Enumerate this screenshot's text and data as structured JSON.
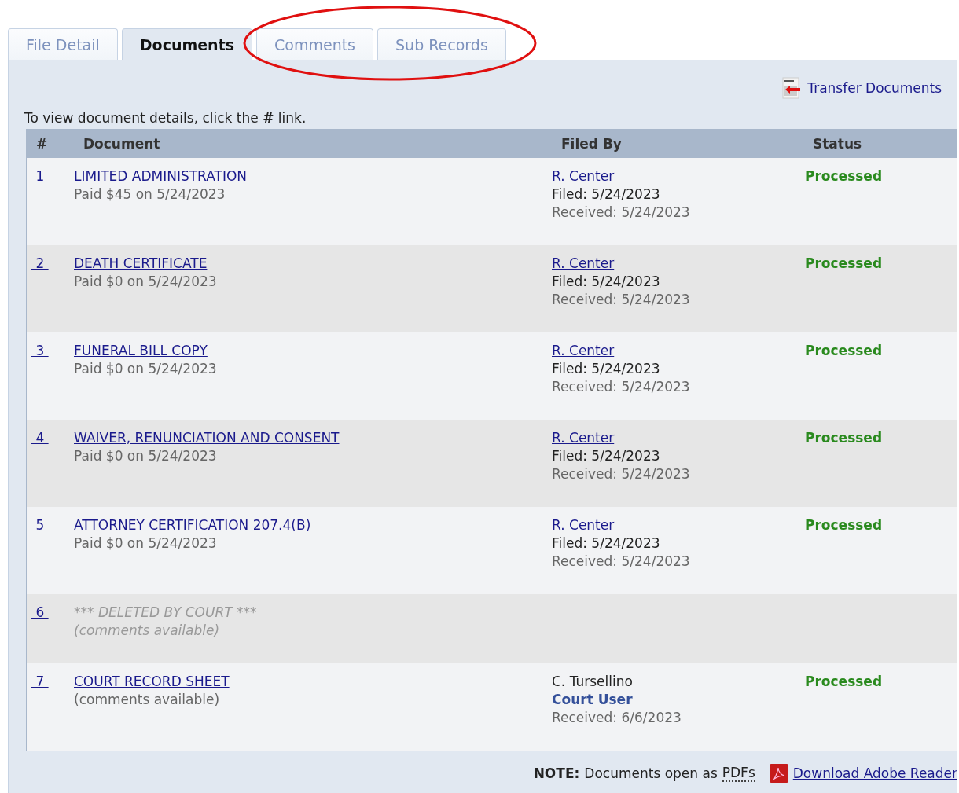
{
  "tabs": [
    {
      "label": "File Detail",
      "selected": false
    },
    {
      "label": "Documents",
      "selected": true
    },
    {
      "label": "Comments",
      "selected": false
    },
    {
      "label": "Sub Records",
      "selected": false
    }
  ],
  "transfer_link": "Transfer Documents",
  "instructions": "To view document details, click the **#** link.",
  "table": {
    "columns": [
      "#",
      "Document",
      "Filed By",
      "Status"
    ],
    "rows": [
      {
        "number": "1",
        "title": "LIMITED ADMINISTRATION",
        "deleted": false,
        "subtitle": "Paid $45 on 5/24/2023",
        "filed_by": [
          {
            "kind": "link",
            "text": "R. Center"
          },
          {
            "kind": "text",
            "text": "Filed: 5/24/2023"
          },
          {
            "kind": "muted",
            "text": "Received: 5/24/2023"
          }
        ],
        "status": "Processed"
      },
      {
        "number": "2",
        "title": "DEATH CERTIFICATE",
        "deleted": false,
        "subtitle": "Paid $0 on 5/24/2023",
        "filed_by": [
          {
            "kind": "link",
            "text": "R. Center"
          },
          {
            "kind": "text",
            "text": "Filed: 5/24/2023"
          },
          {
            "kind": "muted",
            "text": "Received: 5/24/2023"
          }
        ],
        "status": "Processed"
      },
      {
        "number": "3",
        "title": "FUNERAL BILL COPY",
        "deleted": false,
        "subtitle": "Paid $0 on 5/24/2023",
        "filed_by": [
          {
            "kind": "link",
            "text": "R. Center"
          },
          {
            "kind": "text",
            "text": "Filed: 5/24/2023"
          },
          {
            "kind": "muted",
            "text": "Received: 5/24/2023"
          }
        ],
        "status": "Processed"
      },
      {
        "number": "4",
        "title": "WAIVER, RENUNCIATION AND CONSENT",
        "deleted": false,
        "subtitle": "Paid $0 on 5/24/2023",
        "filed_by": [
          {
            "kind": "link",
            "text": "R. Center"
          },
          {
            "kind": "text",
            "text": "Filed: 5/24/2023"
          },
          {
            "kind": "muted",
            "text": "Received: 5/24/2023"
          }
        ],
        "status": "Processed"
      },
      {
        "number": "5",
        "title": "ATTORNEY CERTIFICATION 207.4(B)",
        "deleted": false,
        "subtitle": "Paid $0 on 5/24/2023",
        "filed_by": [
          {
            "kind": "link",
            "text": "R. Center"
          },
          {
            "kind": "text",
            "text": "Filed: 5/24/2023"
          },
          {
            "kind": "muted",
            "text": "Received: 5/24/2023"
          }
        ],
        "status": "Processed"
      },
      {
        "number": "6",
        "title": "*** DELETED BY COURT ***",
        "deleted": true,
        "subtitle": "(comments available)"
      },
      {
        "number": "7",
        "title": "COURT RECORD SHEET",
        "deleted": false,
        "subtitle": "(comments available)",
        "filed_by": [
          {
            "kind": "text",
            "text": "C. Tursellino"
          },
          {
            "kind": "role",
            "text": "Court User"
          },
          {
            "kind": "muted",
            "text": "Received: 6/6/2023"
          }
        ],
        "status": "Processed"
      }
    ]
  },
  "footer": {
    "note_label": "NOTE:",
    "note_text": "Documents open as",
    "pdf_term": "PDFs",
    "download_link": "Download Adobe Reader"
  }
}
